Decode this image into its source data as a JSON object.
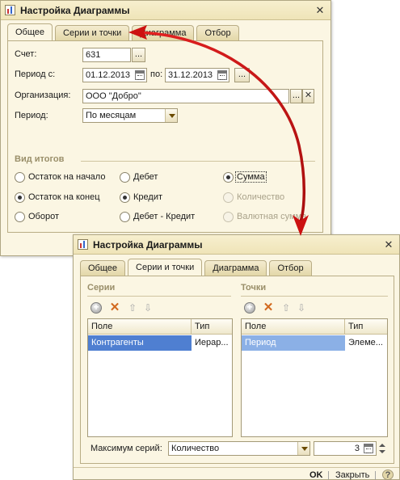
{
  "dialog1": {
    "title": "Настройка Диаграммы",
    "close_glyph": "✕",
    "tabs": [
      "Общее",
      "Серии и точки",
      "Диаграмма",
      "Отбор"
    ],
    "active_tab": "Общее",
    "account": {
      "label": "Счет:",
      "value": "631",
      "select_glyph": "..."
    },
    "period_range": {
      "label": "Период с:",
      "from": "01.12.2013",
      "to_label": "по:",
      "to": "31.12.2013",
      "select_glyph": "..."
    },
    "organization": {
      "label": "Организация:",
      "value": "ООО \"Добро\"",
      "select_glyph": "...",
      "clear_glyph": "✕"
    },
    "periodicity": {
      "label": "Период:",
      "value": "По месяцам"
    },
    "totals": {
      "title": "Вид итогов",
      "col1": [
        {
          "label": "Остаток на начало",
          "checked": false,
          "disabled": false
        },
        {
          "label": "Остаток на конец",
          "checked": true,
          "disabled": false
        },
        {
          "label": "Оборот",
          "checked": false,
          "disabled": false
        }
      ],
      "col2": [
        {
          "label": "Дебет",
          "checked": false,
          "disabled": false
        },
        {
          "label": "Кредит",
          "checked": true,
          "disabled": false
        },
        {
          "label": "Дебет - Кредит",
          "checked": false,
          "disabled": false
        }
      ],
      "col3": [
        {
          "label": "Сумма",
          "checked": true,
          "disabled": false
        },
        {
          "label": "Количество",
          "checked": false,
          "disabled": true
        },
        {
          "label": "Валютная сумма",
          "checked": false,
          "disabled": true
        }
      ]
    }
  },
  "dialog2": {
    "title": "Настройка Диаграммы",
    "close_glyph": "✕",
    "tabs": [
      "Общее",
      "Серии и точки",
      "Диаграмма",
      "Отбор"
    ],
    "active_tab": "Серии и точки",
    "series": {
      "title": "Серии",
      "columns": [
        "Поле",
        "Тип"
      ],
      "rows": [
        {
          "field": "Контрагенты",
          "type": "Иерар..."
        }
      ]
    },
    "points": {
      "title": "Точки",
      "columns": [
        "Поле",
        "Тип"
      ],
      "rows": [
        {
          "field": "Период",
          "type": "Элеме..."
        }
      ]
    },
    "max_series": {
      "label": "Максимум серий:",
      "mode": "Количество",
      "count": "3"
    },
    "footer": {
      "ok": "OK",
      "close": "Закрыть"
    }
  },
  "colors": {
    "window_bg": "#fbf6e3",
    "selection": "#4f7fd1",
    "annotation_arrow": "#cc1111"
  }
}
